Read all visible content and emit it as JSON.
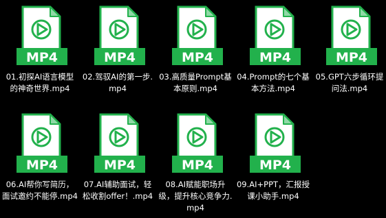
{
  "icons": {
    "file_icon": "mp4-video-file-icon",
    "play_icon": "play-icon"
  },
  "colors": {
    "background": "#000000",
    "file_green": "#22b14c",
    "file_fold": "#8fd9a6",
    "icon_body": "#ffffff",
    "label_text": "#ffffff"
  },
  "files": [
    {
      "badge": "MP4",
      "name": "01.初探AI语言模型的神奇世界.mp4"
    },
    {
      "badge": "MP4",
      "name": "02.驾驭AI的第一步.mp4"
    },
    {
      "badge": "MP4",
      "name": "03.高质量Prompt基本原则.mp4"
    },
    {
      "badge": "MP4",
      "name": "04.Prompt的七个基本方法.mp4"
    },
    {
      "badge": "MP4",
      "name": "05.GPT六步循环提问法.mp4"
    },
    {
      "badge": "MP4",
      "name": "06.AI帮你写简历，面试邀约不能停.mp4"
    },
    {
      "badge": "MP4",
      "name": "07.AI辅助面试，轻松收割offer！.mp4"
    },
    {
      "badge": "MP4",
      "name": "08.AI赋能职场升级，提升核心竞争力.mp4"
    },
    {
      "badge": "MP4",
      "name": "09.AI+PPT，汇报授课小助手.mp4"
    }
  ]
}
